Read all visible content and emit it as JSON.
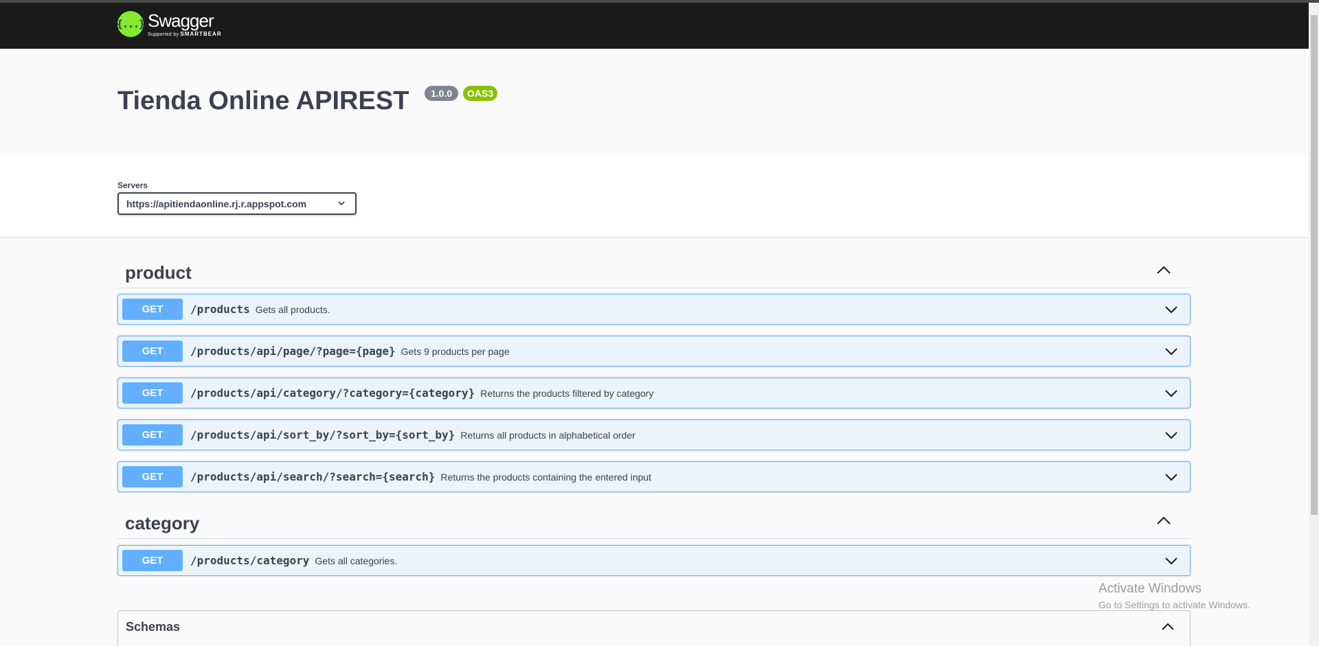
{
  "header": {
    "logo_icon": "{...}",
    "logo_name": "Swagger",
    "logo_sub_prefix": "Supported by",
    "logo_sub_brand": "SMARTBEAR"
  },
  "info": {
    "title": "Tienda Online APIREST",
    "version": "1.0.0",
    "oas": "OAS3"
  },
  "servers": {
    "label": "Servers",
    "selected": "https://apitiendaonline.rj.r.appspot.com"
  },
  "tags": [
    {
      "name": "product",
      "operations": [
        {
          "method": "GET",
          "path": "/products",
          "summary": "Gets all products."
        },
        {
          "method": "GET",
          "path": "/products/api/page/?page={page}",
          "summary": "Gets 9 products per page"
        },
        {
          "method": "GET",
          "path": "/products/api/category/?category={category}",
          "summary": "Returns the products filtered by category"
        },
        {
          "method": "GET",
          "path": "/products/api/sort_by/?sort_by={sort_by}",
          "summary": "Returns all products in alphabetical order"
        },
        {
          "method": "GET",
          "path": "/products/api/search/?search={search}",
          "summary": "Returns the products containing the entered input"
        }
      ]
    },
    {
      "name": "category",
      "operations": [
        {
          "method": "GET",
          "path": "/products/category",
          "summary": "Gets all categories."
        }
      ]
    }
  ],
  "schemas": {
    "title": "Schemas"
  },
  "watermark": {
    "title": "Activate Windows",
    "subtitle": "Go to Settings to activate Windows."
  },
  "colors": {
    "get_method": "#61affe",
    "get_background": "#ebf3fb",
    "oas_badge": "#89bf04",
    "version_badge": "#7d8492",
    "topbar": "#1b1b1b",
    "logo": "#85ea2d"
  },
  "icons": {
    "tag_toggle": "chevron-up-icon",
    "operation_toggle": "chevron-down-icon",
    "server_select": "chevron-down-icon"
  }
}
